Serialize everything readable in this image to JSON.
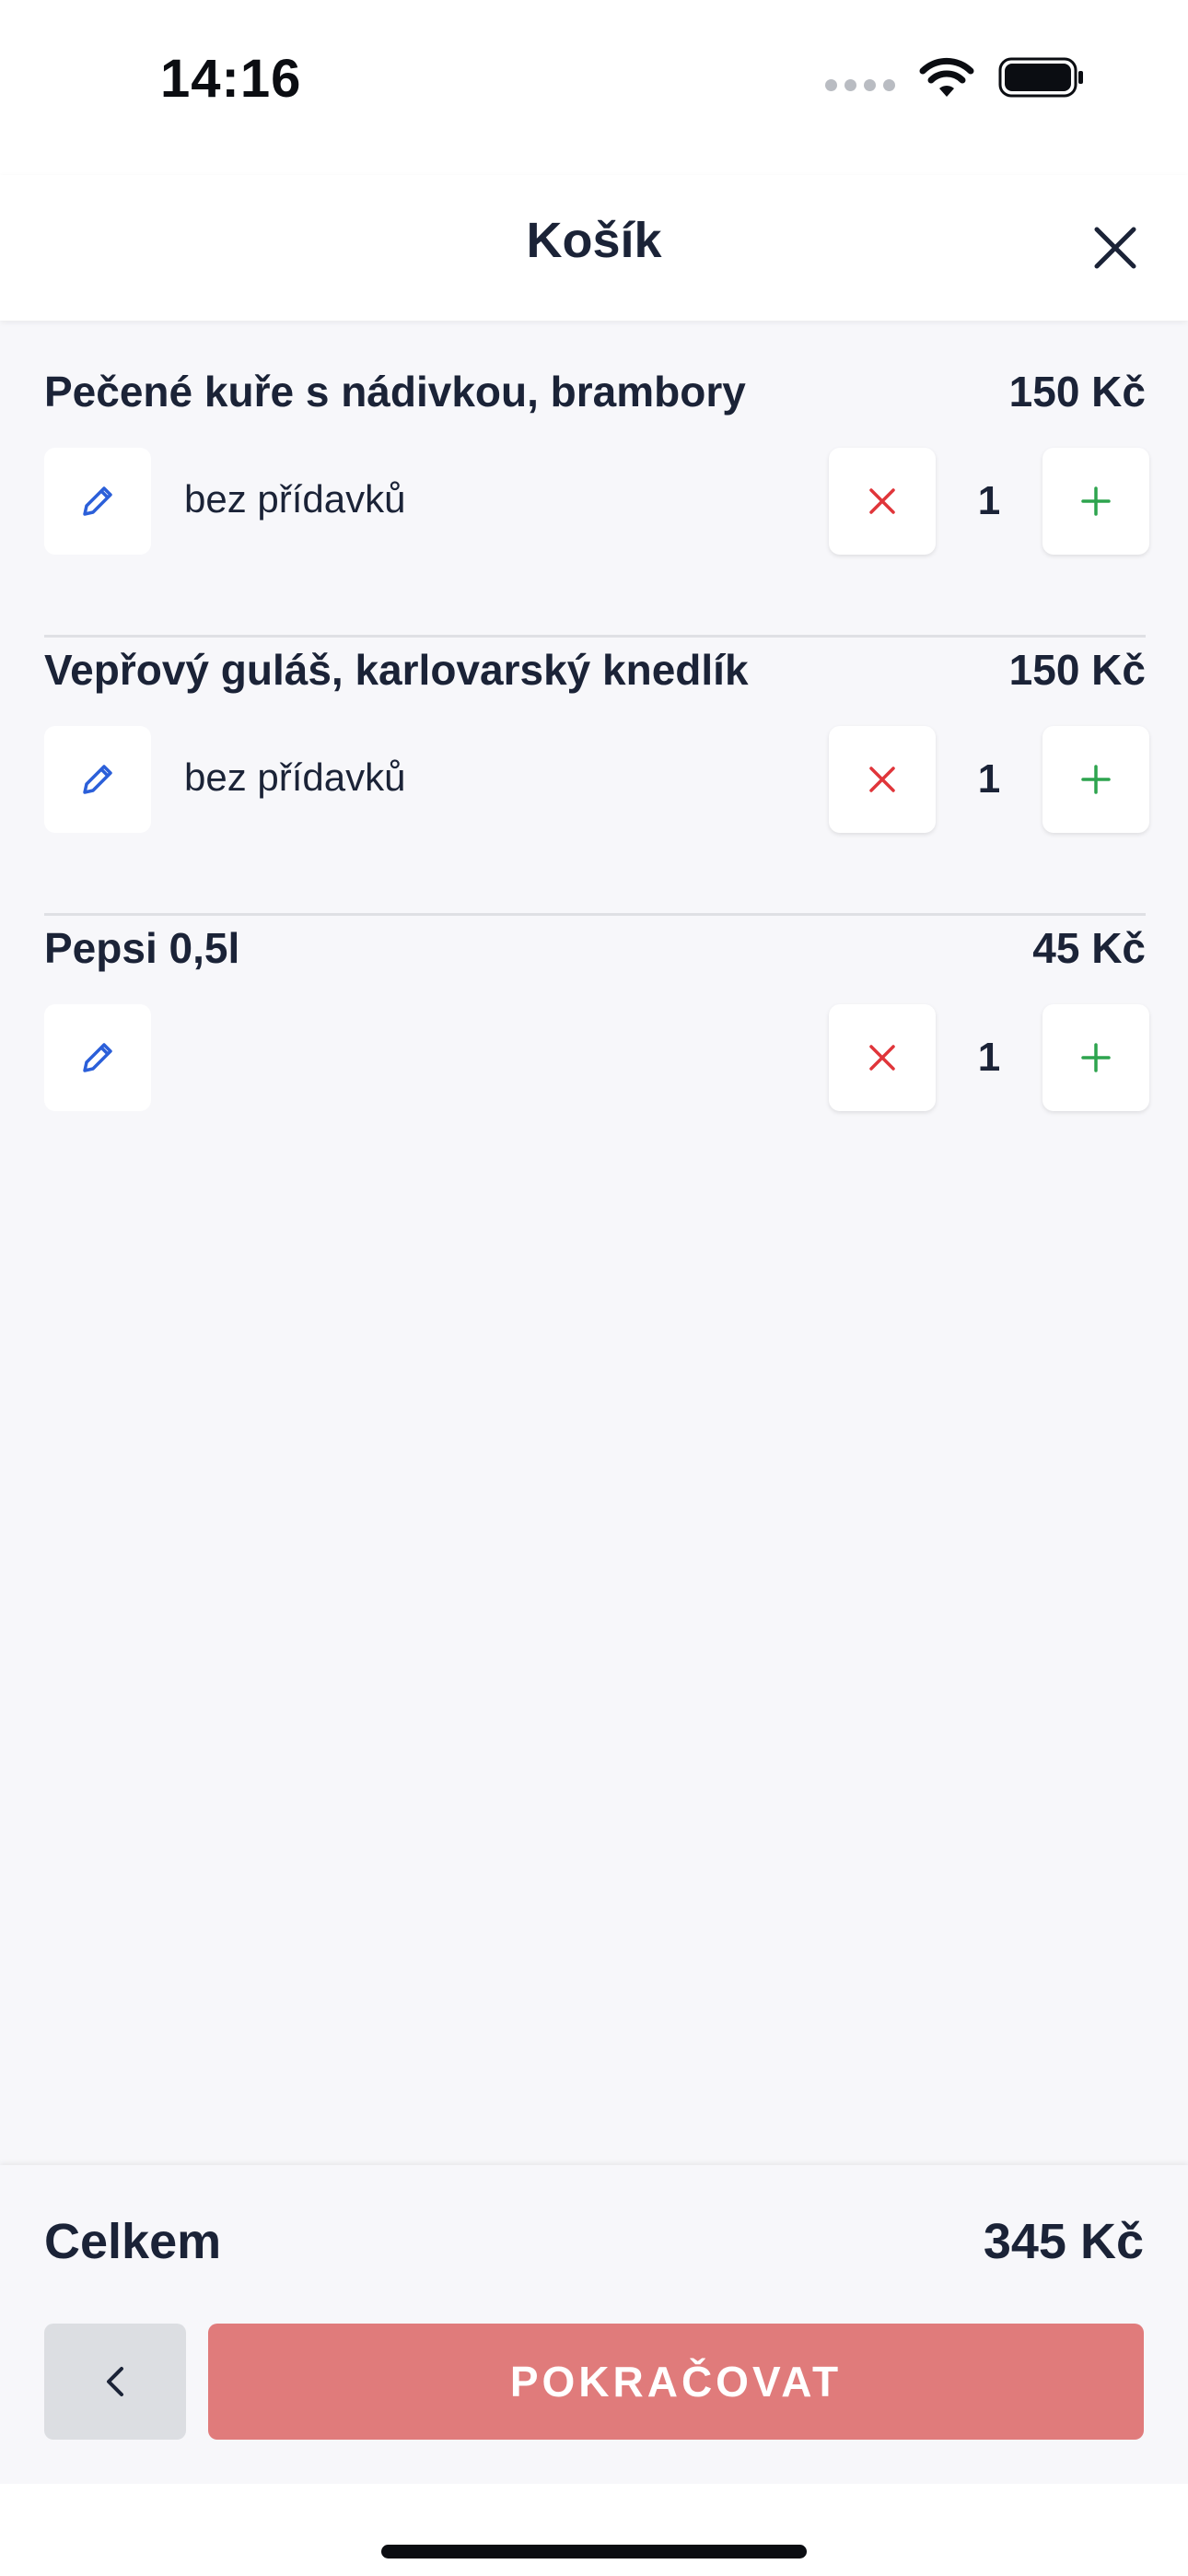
{
  "status_bar": {
    "time": "14:16"
  },
  "header": {
    "title": "Košík"
  },
  "colors": {
    "text": "#1b2337",
    "remove": "#e0353a",
    "add": "#2da44e",
    "edit": "#2b5fd9",
    "continue_button": "#e07b7b",
    "back_button": "#dcdee2"
  },
  "icons": {
    "close": "close-icon",
    "edit": "pencil-icon",
    "remove": "x-icon",
    "add": "plus-icon",
    "back": "chevron-left-icon"
  },
  "items": [
    {
      "name": "Pečené kuře s nádivkou, brambory",
      "price": "150 Kč",
      "note": "bez přídavků",
      "qty": "1"
    },
    {
      "name": "Vepřový guláš, karlovarský knedlík",
      "price": "150 Kč",
      "note": "bez přídavků",
      "qty": "1"
    },
    {
      "name": "Pepsi 0,5l",
      "price": "45 Kč",
      "note": "",
      "qty": "1"
    }
  ],
  "footer": {
    "total_label": "Celkem",
    "total_value": "345 Kč",
    "continue_label": "POKRAČOVAT"
  }
}
